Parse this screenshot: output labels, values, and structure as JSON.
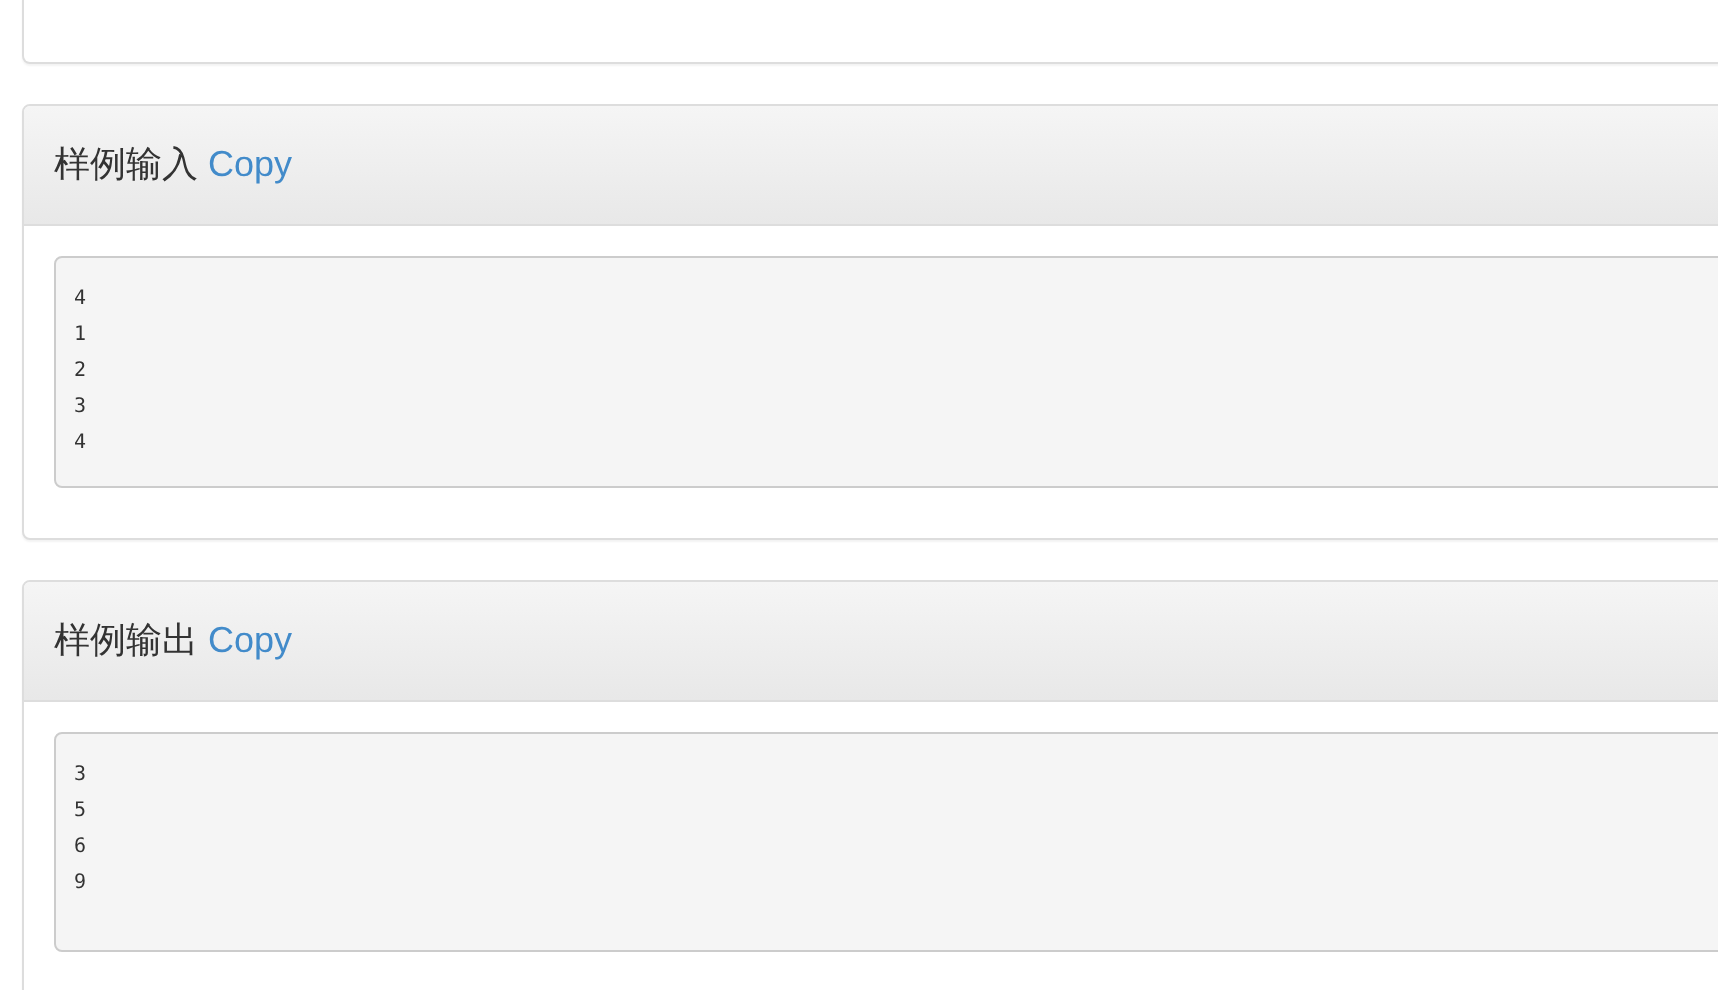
{
  "panels": [
    {
      "title": "样例输入",
      "link": "Copy",
      "lines": [
        "4",
        "1",
        "2",
        "3",
        "4"
      ]
    },
    {
      "title": "样例输出",
      "link": "Copy",
      "lines": [
        "3",
        "5",
        "6",
        "9"
      ]
    }
  ]
}
